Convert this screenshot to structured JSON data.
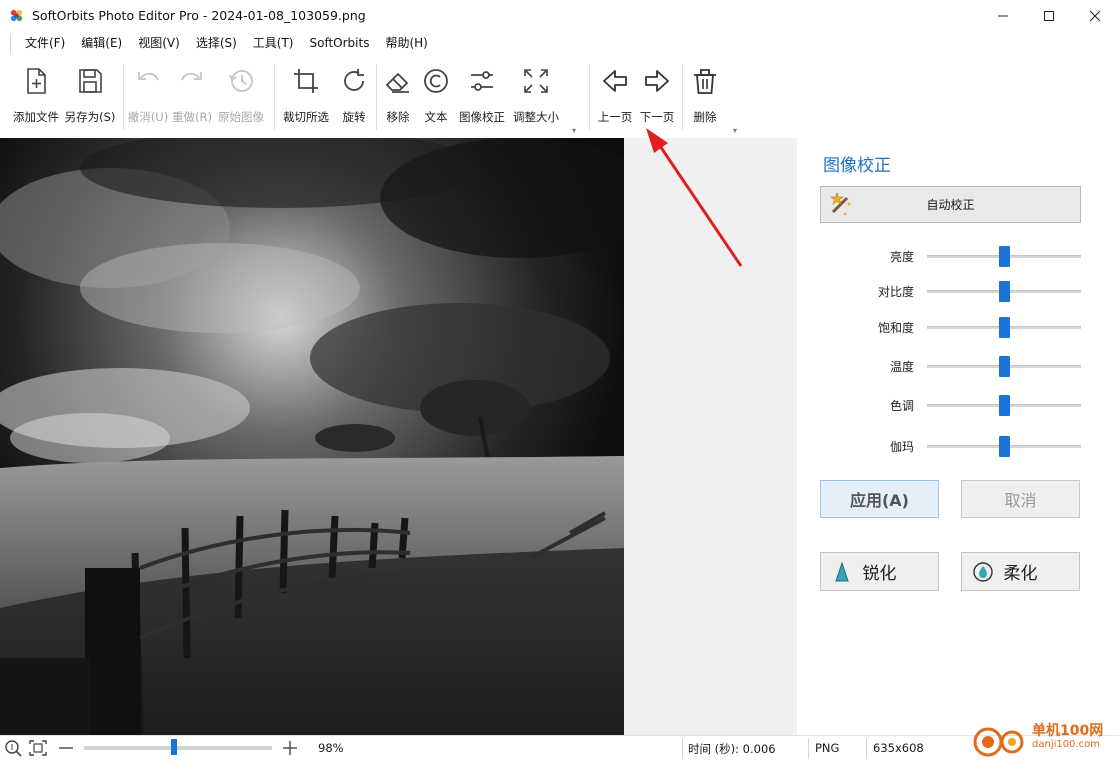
{
  "window": {
    "title": "SoftOrbits Photo Editor Pro - 2024-01-08_103059.png",
    "app_icon": "softorbits-flower-icon"
  },
  "menu": [
    "文件(F)",
    "编辑(E)",
    "视图(V)",
    "选择(S)",
    "工具(T)",
    "SoftOrbits",
    "帮助(H)"
  ],
  "toolbar": {
    "add_file": "添加文件",
    "save_as": "另存为(S)",
    "undo": "撤消(U)",
    "redo": "重做(R)",
    "original": "原始图像",
    "crop": "裁切所选",
    "rotate": "旋转",
    "remove": "移除",
    "text": "文本",
    "image_correct": "图像校正",
    "resize": "调整大小",
    "prev_page": "上一页",
    "next_page": "下一页",
    "delete": "删除"
  },
  "panel": {
    "title": "图像校正",
    "auto_correct": "自动校正",
    "sliders": [
      {
        "label": "亮度",
        "value": 0.5
      },
      {
        "label": "对比度",
        "value": 0.5
      },
      {
        "label": "饱和度",
        "value": 0.5
      },
      {
        "label": "温度",
        "value": 0.5
      },
      {
        "label": "色调",
        "value": 0.5
      },
      {
        "label": "伽玛",
        "value": 0.5
      }
    ],
    "apply": "应用(A)",
    "cancel": "取消",
    "sharpen": "锐化",
    "soften": "柔化"
  },
  "status": {
    "zoom": "98%",
    "zoom_level": 0.48,
    "time": "时间 (秒): 0.006",
    "format": "PNG",
    "dimensions": "635x608"
  },
  "watermark": {
    "text": "单机100网",
    "sub": "danji100.com"
  },
  "colors": {
    "accent": "#1a74d8",
    "panel_title": "#1e6fc8",
    "annotation_arrow": "#e02020"
  }
}
